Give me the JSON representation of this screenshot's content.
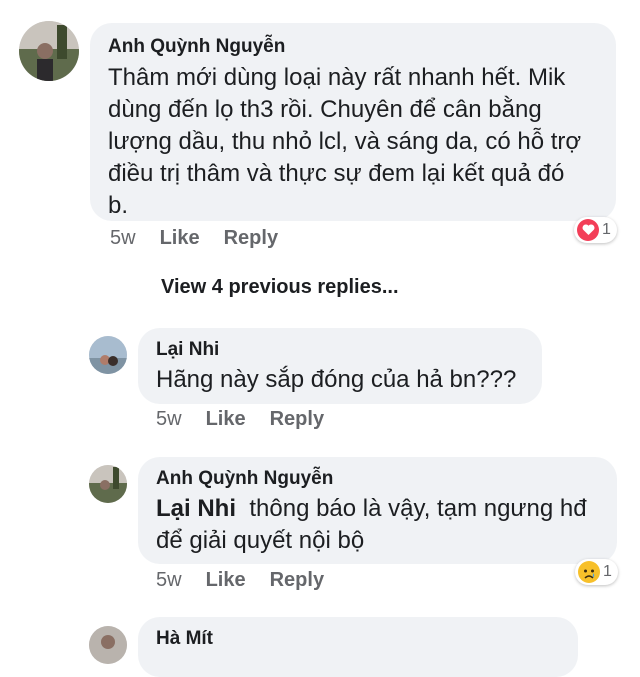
{
  "comments": [
    {
      "author": "Anh Quỳnh Nguyễn",
      "lines": [
        "Thâm mới dùng loại này rất nhanh hết. Mik",
        "dùng đến lọ th3 rồi. Chuyên để cân bằng",
        "lượng dầu, thu nhỏ lcl, và sáng da, có hỗ trợ",
        "điều trị thâm và thực sự đem lại kết quả đó",
        "b."
      ],
      "time": "5w",
      "like_label": "Like",
      "reply_label": "Reply",
      "reaction": {
        "icon": "heart-icon",
        "count": "1",
        "color": "#f33e58"
      }
    }
  ],
  "view_previous": "View 4 previous replies...",
  "replies": [
    {
      "author": "Lại Nhi",
      "text": "Hãng này sắp đóng của hả bn???",
      "time": "5w",
      "like_label": "Like",
      "reply_label": "Reply"
    },
    {
      "author": "Anh Quỳnh Nguyễn",
      "mention": "Lại Nhi",
      "line1": "thông báo là vậy, tạm ngưng hđ",
      "line2": "để giải quyết nội bộ",
      "time": "5w",
      "like_label": "Like",
      "reply_label": "Reply",
      "reaction": {
        "icon": "sad-face-icon",
        "count": "1",
        "color": "#f7c02a"
      }
    },
    {
      "author": "Hà Mít"
    }
  ]
}
